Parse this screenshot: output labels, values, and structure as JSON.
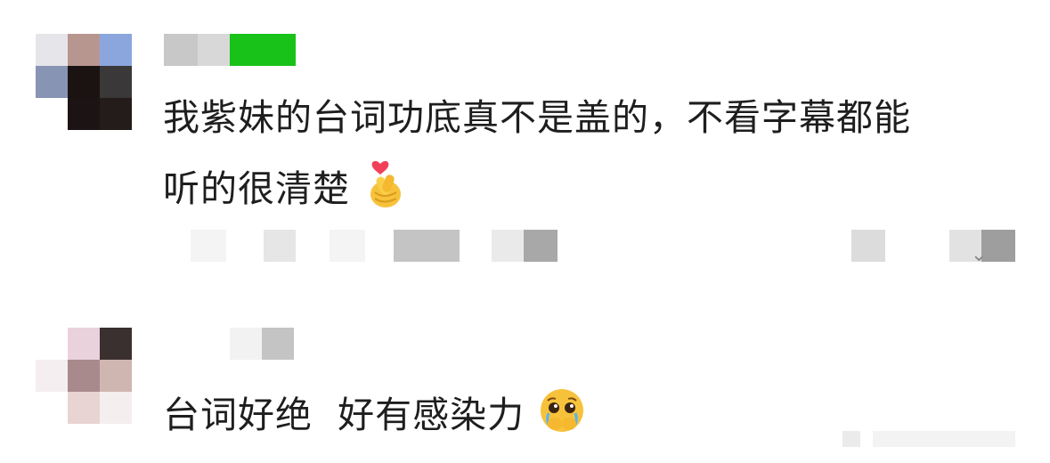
{
  "comments": [
    {
      "line1": "我紫妹的台词功底真不是盖的，不看字幕都能",
      "line2": "听的很清楚",
      "emoji": "finger-heart-emoji"
    },
    {
      "line1": "台词好绝  好有感染力",
      "emoji": "pleading-face-emoji"
    }
  ],
  "colors": {
    "text": "#1e1e1e",
    "username_accent": "#19c219",
    "blur_gray": "#c8c8c8"
  }
}
